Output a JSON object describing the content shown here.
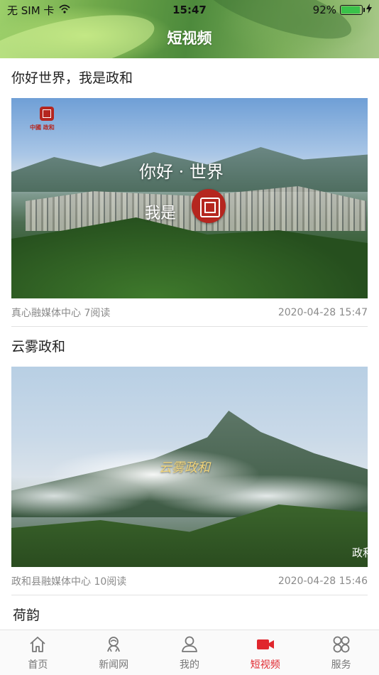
{
  "status_bar": {
    "carrier": "无 SIM 卡",
    "time": "15:47",
    "battery_percent": "92%",
    "battery_level": 0.92
  },
  "header": {
    "title": "短视频"
  },
  "feed": [
    {
      "title": "你好世界，我是政和",
      "thumb_text_line1": "你好 · 世界",
      "thumb_text_line2": "我是",
      "logo_text": "中國 政和",
      "source": "真心融媒体中心 7阅读",
      "datetime": "2020-04-28 15:47"
    },
    {
      "title": "云雾政和",
      "thumb_text": "云雾政和",
      "thumb_corner_text": "政和",
      "source": "政和县融媒体中心 10阅读",
      "datetime": "2020-04-28 15:46"
    },
    {
      "title": "荷韵"
    }
  ],
  "tabs": [
    {
      "label": "首页",
      "icon": "home-icon",
      "active": false
    },
    {
      "label": "新闻网",
      "icon": "news-icon",
      "active": false
    },
    {
      "label": "我的",
      "icon": "user-icon",
      "active": false
    },
    {
      "label": "短视频",
      "icon": "video-camera-icon",
      "active": true
    },
    {
      "label": "服务",
      "icon": "grid-icon",
      "active": false
    }
  ],
  "colors": {
    "accent": "#e0262d",
    "tab_inactive": "#777777",
    "meta_text": "#8a8a8a"
  }
}
